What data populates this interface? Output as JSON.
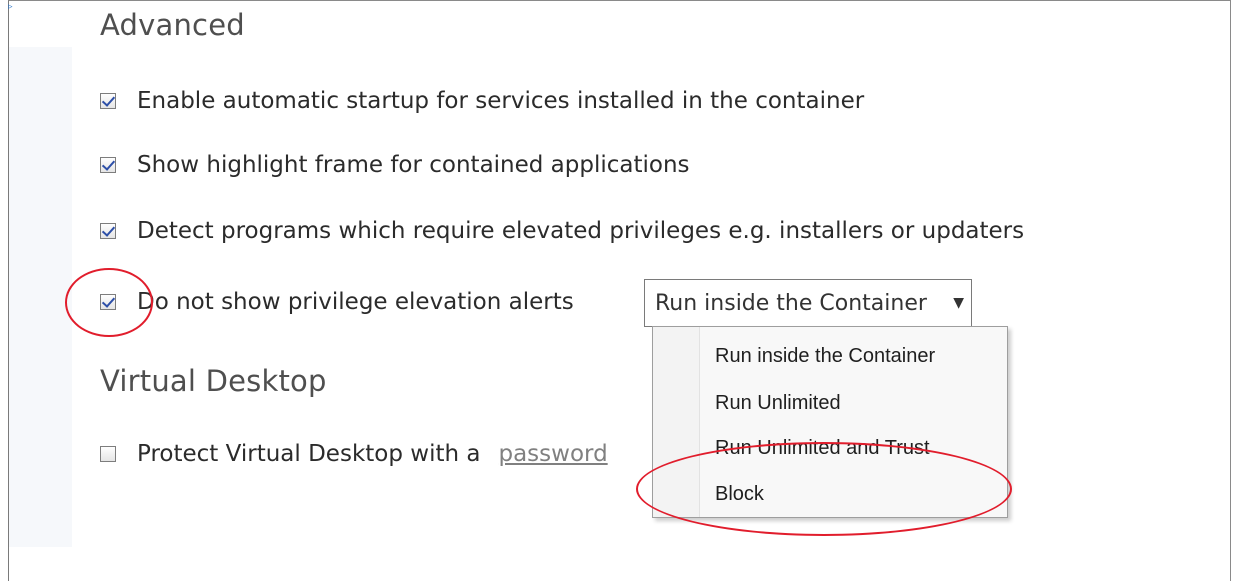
{
  "advanced": {
    "heading": "Advanced",
    "options": [
      {
        "label": "Enable automatic startup for services installed in the container",
        "checked": true
      },
      {
        "label": "Show highlight frame for contained applications",
        "checked": true
      },
      {
        "label": "Detect programs which require elevated privileges e.g. installers or updaters",
        "checked": true
      },
      {
        "label": "Do not show privilege elevation alerts",
        "checked": true
      }
    ],
    "alert_action_select": {
      "selected": "Run inside the Container",
      "options": [
        "Run inside the Container",
        "Run Unlimited",
        "Run Unlimited and Trust",
        "Block"
      ]
    }
  },
  "virtual_desktop": {
    "heading": "Virtual Desktop",
    "protect_label": "Protect Virtual Desktop with a",
    "protect_checked": false,
    "password_link": "password"
  },
  "colors": {
    "annotation": "#e11d2c",
    "checkmark": "#2d4fa8"
  }
}
